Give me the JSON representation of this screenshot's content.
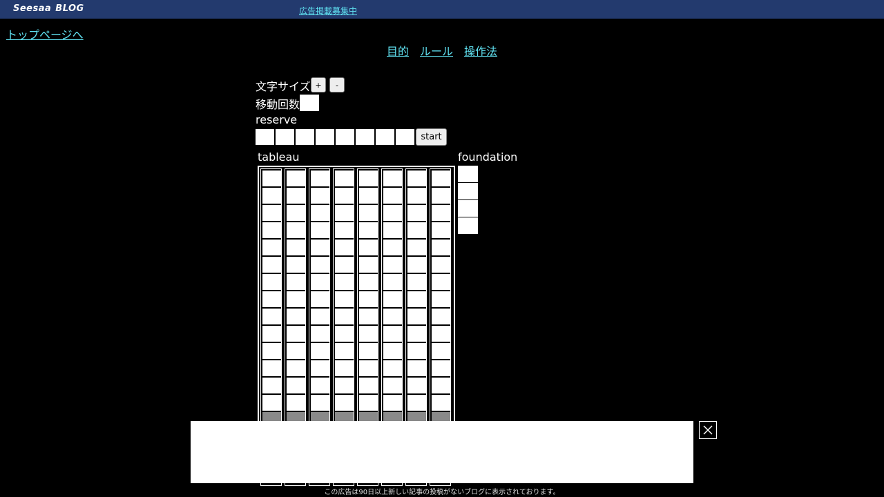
{
  "header": {
    "brand_name": "Seesaa",
    "brand_suffix": "BLOG",
    "ad_link": "広告掲載募集中"
  },
  "home_link": "トップページへ",
  "nav": {
    "items": [
      "目的",
      "ルール",
      "操作法"
    ]
  },
  "controls": {
    "font_size_label": "文字サイズ",
    "plus_label": "+",
    "minus_label": "-",
    "moves_label": "移動回数",
    "moves_value": ""
  },
  "reserve": {
    "label": "reserve",
    "slots": 8,
    "start_label": "start"
  },
  "tableau": {
    "label": "tableau",
    "columns": 8
  },
  "foundation": {
    "label": "foundation",
    "slots": 4
  },
  "ad": {
    "note": "この広告は90日以上新しい記事の投稿がないブログに表示されております。"
  }
}
